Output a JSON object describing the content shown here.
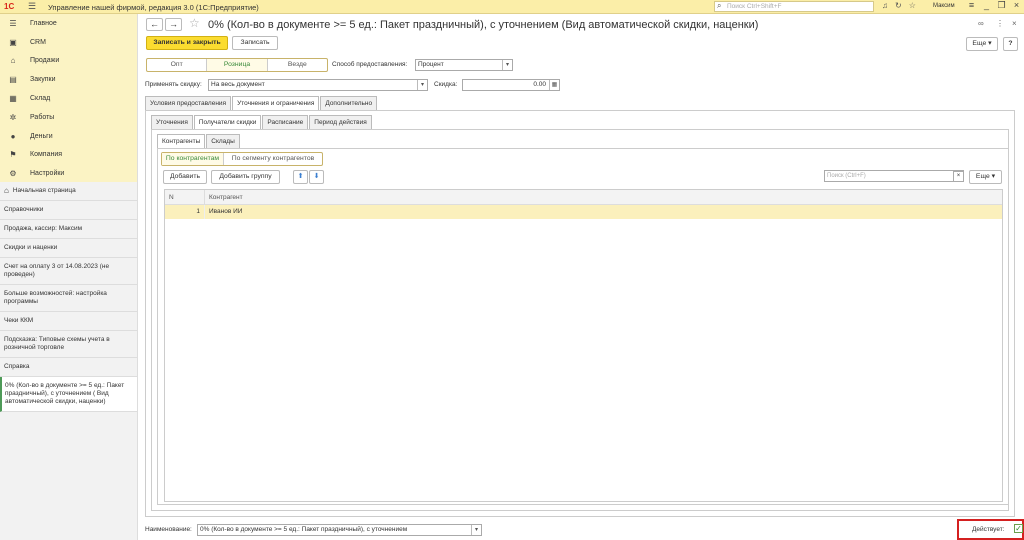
{
  "titlebar": {
    "logo": "1С",
    "title": "Управление нашей фирмой, редакция 3.0  (1С:Предприятие)",
    "search_placeholder": "Поиск Ctrl+Shift+F",
    "user": "Максим"
  },
  "sidebar": {
    "sections": [
      {
        "label": "Главное",
        "icon": "menu-icon"
      },
      {
        "label": "CRM",
        "icon": "crm-icon"
      },
      {
        "label": "Продажи",
        "icon": "sales-icon"
      },
      {
        "label": "Закупки",
        "icon": "purchases-icon"
      },
      {
        "label": "Склад",
        "icon": "warehouse-icon"
      },
      {
        "label": "Работы",
        "icon": "works-icon"
      },
      {
        "label": "Деньги",
        "icon": "money-icon"
      },
      {
        "label": "Компания",
        "icon": "company-icon"
      },
      {
        "label": "Настройки",
        "icon": "settings-icon"
      }
    ],
    "open_windows": [
      "Начальная страница",
      "Справочники",
      "Продажа, кассир: Максим",
      "Скидки и наценки",
      "Счет на оплату 3 от 14.08.2023 (не проведен)",
      "Больше возможностей: настройка программы",
      "Чеки ККМ",
      "Подсказка: Типовые схемы учета в розничной торговле",
      "Справка",
      "0% (Кол-во в документе >= 5 ед.: Пакет праздничный), с уточнением ( Вид автоматической скидки, наценки)"
    ]
  },
  "doc": {
    "title": "0% (Кол-во в документе >= 5 ед.: Пакет праздничный), с уточнением (Вид автоматической скидки, наценки)",
    "save_close": "Записать и закрыть",
    "save": "Записать",
    "more": "Еще",
    "help": "?",
    "segments": [
      "Опт",
      "Розница",
      "Везде"
    ],
    "method_label": "Способ предоставления:",
    "method_value": "Процент",
    "apply_label": "Применять скидку:",
    "apply_value": "На весь документ",
    "discount_label": "Скидка:",
    "discount_value": "0.00",
    "tabs1": [
      "Условия предоставления",
      "Уточнения и ограничения",
      "Дополнительно"
    ],
    "tabs2": [
      "Уточнения",
      "Получатели скидки",
      "Расписание",
      "Период действия"
    ],
    "tabs3": [
      "Контрагенты",
      "Склады"
    ],
    "filter": [
      "По контрагентам",
      "По сегменту контрагентов"
    ],
    "add": "Добавить",
    "add_group": "Добавить группу",
    "search_placeholder": "Поиск (Ctrl+F)",
    "clear": "×",
    "grid_headers": [
      "N",
      "Контрагент"
    ],
    "rows": [
      {
        "n": "1",
        "name": "Иванов ИИ"
      }
    ],
    "name_label": "Наименование:",
    "name_value": "0% (Кол-во в документе >= 5 ед.: Пакет праздничный), с уточнением",
    "active_label": "Действует:"
  }
}
